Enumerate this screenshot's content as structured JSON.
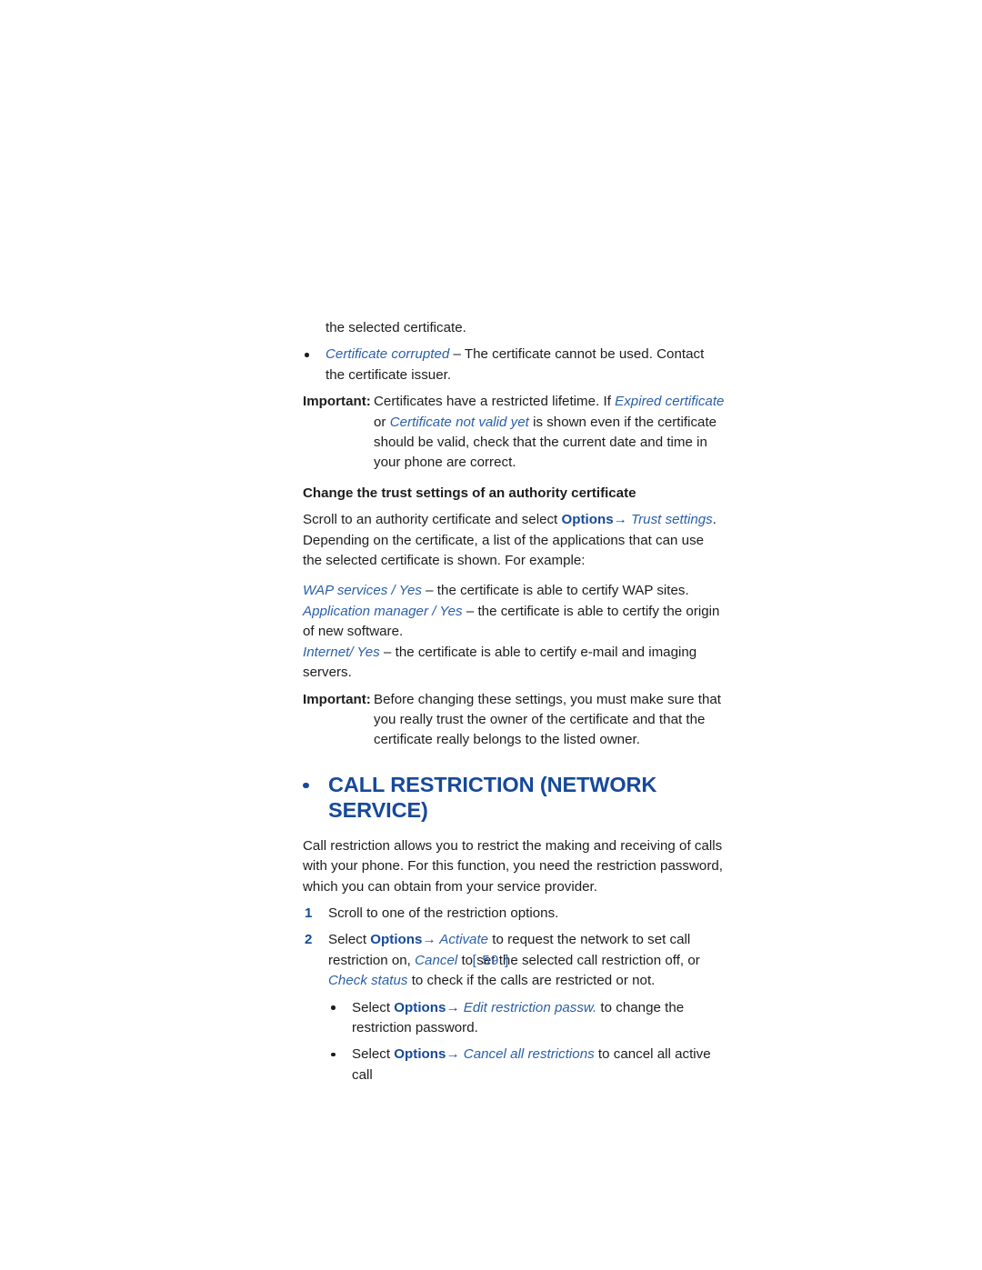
{
  "document": {
    "page_number_label": "[ 59 ]",
    "accent_blue": "#16499a",
    "italic_blue": "#2b5fa8",
    "body_color": "#1d1d1d"
  },
  "content": {
    "continuation_line": "the selected certificate.",
    "bullet_cert_corrupted": {
      "term": "Certificate corrupted",
      "rest": " – The certificate cannot be used. Contact the certificate issuer."
    },
    "important_1": {
      "label": "Important:",
      "part1": "Certificates have a restricted lifetime. If ",
      "em1": "Expired certificate",
      "part2": " or ",
      "em2": "Certificate not valid yet",
      "part3": " is shown even if the certificate should be valid, check that the current date and time in your phone are correct."
    },
    "subhead_trust": "Change the trust settings of an authority certificate",
    "para_scroll_authority": {
      "part1": "Scroll to an authority certificate and select ",
      "bold1": "Options",
      "arrow": "→",
      "em1": " Trust settings",
      "part2": ". Depending on the certificate, a list of the applications that can use the selected certificate is shown. For example:"
    },
    "example_wap": {
      "em1": "WAP services",
      "sep": " / ",
      "em2": "Yes",
      "rest": " – the certificate is able to certify WAP sites."
    },
    "example_appmgr": {
      "em1": "Application manager",
      "sep": " / ",
      "em2": "Yes",
      "rest": " – the certificate is able to certify the origin of new software."
    },
    "example_internet": {
      "em1": "Internet",
      "sep": "/ ",
      "em2": "Yes",
      "rest": " – the certificate is able to certify e-mail and imaging servers."
    },
    "important_2": {
      "label": "Important:",
      "text": "Before changing these settings, you must make sure that you really trust the owner of the certificate and that the certificate really belongs to the listed owner."
    },
    "section_heading": "CALL RESTRICTION (NETWORK SERVICE)",
    "para_call_restriction": "Call restriction allows you to restrict the making and receiving of calls with your phone. For this function, you need the restriction password, which you can obtain from your service provider.",
    "step_1": {
      "number": "1",
      "text": "Scroll to one of the restriction options."
    },
    "step_2": {
      "number": "2",
      "part1": "Select ",
      "bold1": "Options",
      "arrow": "→",
      "em1": " Activate",
      "part2": " to request the network to set call restriction on, ",
      "em2": "Cancel",
      "part3": " to set the selected call restriction off, or ",
      "em3": "Check status",
      "part4": " to check if the calls are restricted or not."
    },
    "sub_bullet_edit_passw": {
      "part1": "Select ",
      "bold1": "Options",
      "arrow": "→",
      "em1": " Edit restriction passw.",
      "part2": " to change the restriction password."
    },
    "sub_bullet_cancel_all": {
      "part1": "Select ",
      "bold1": "Options",
      "arrow": "→",
      "em1": " Cancel all restrictions",
      "part2": " to cancel all active call"
    }
  }
}
